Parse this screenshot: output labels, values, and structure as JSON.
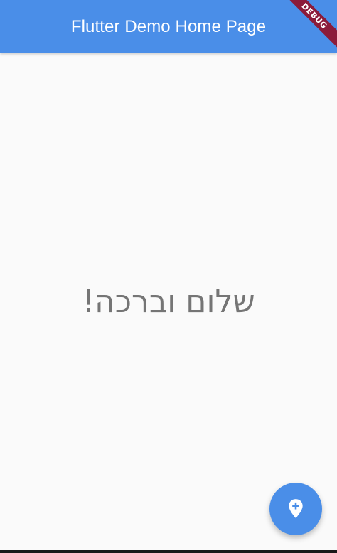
{
  "app_bar": {
    "title": "Flutter Demo Home Page"
  },
  "debug_banner": {
    "label": "DEBUG"
  },
  "main": {
    "greeting": "שלום וברכה!"
  },
  "fab": {
    "icon": "add-location-icon"
  },
  "colors": {
    "primary": "#4a8ee8",
    "background": "#fafafa",
    "text": "#757575",
    "debug_banner": "#8b1b3a"
  }
}
